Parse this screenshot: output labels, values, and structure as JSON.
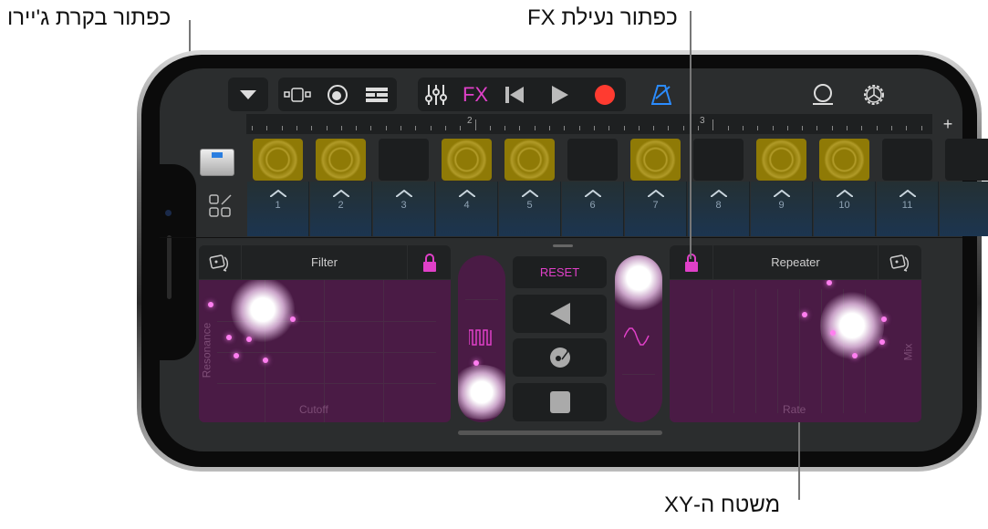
{
  "callouts": {
    "gyro_button": "כפתור בקרת ג'יירו",
    "fx_lock_button": "כפתור נעילת FX",
    "xy_pad": "משטח ה-XY"
  },
  "toolbar": {
    "fx_label": "FX",
    "icons": [
      "triangle-down-icon",
      "live-loops-grid-icon",
      "drummer-icon",
      "tracks-view-icon",
      "mixer-icon",
      "fx-icon",
      "go-to-beginning-icon",
      "play-icon",
      "record-icon",
      "metronome-icon",
      "loop-browser-icon",
      "settings-gear-icon"
    ],
    "colors": {
      "fx": "#e040c8",
      "record": "#ff3b30",
      "metronome": "#2b8cff"
    }
  },
  "ruler": {
    "marks": [
      "2",
      "3"
    ],
    "add_label": "+"
  },
  "tracks": {
    "instrument_icon": "drum-machine-icon",
    "edit_icon": "edit-cells-icon",
    "pads_active": [
      true,
      true,
      false,
      true,
      true,
      false,
      true,
      false,
      true,
      true,
      false
    ],
    "pad_color": "#8f7a06",
    "columns": [
      "1",
      "2",
      "3",
      "4",
      "5",
      "6",
      "7",
      "8",
      "9",
      "10",
      "11"
    ]
  },
  "fx": {
    "left": {
      "title": "Filter",
      "x_axis": "Cutoff",
      "y_axis": "Resonance",
      "locked": true
    },
    "right": {
      "title": "Repeater",
      "x_axis": "Rate",
      "y_axis": "Mix",
      "locked": true
    },
    "reset_label": "RESET",
    "accent": "#e040c8",
    "buttons": [
      "reverse-icon",
      "turntable-scratch-icon",
      "stop-icon"
    ],
    "left_strip_icon": "square-wave-icon",
    "right_strip_icon": "sine-wave-icon"
  }
}
